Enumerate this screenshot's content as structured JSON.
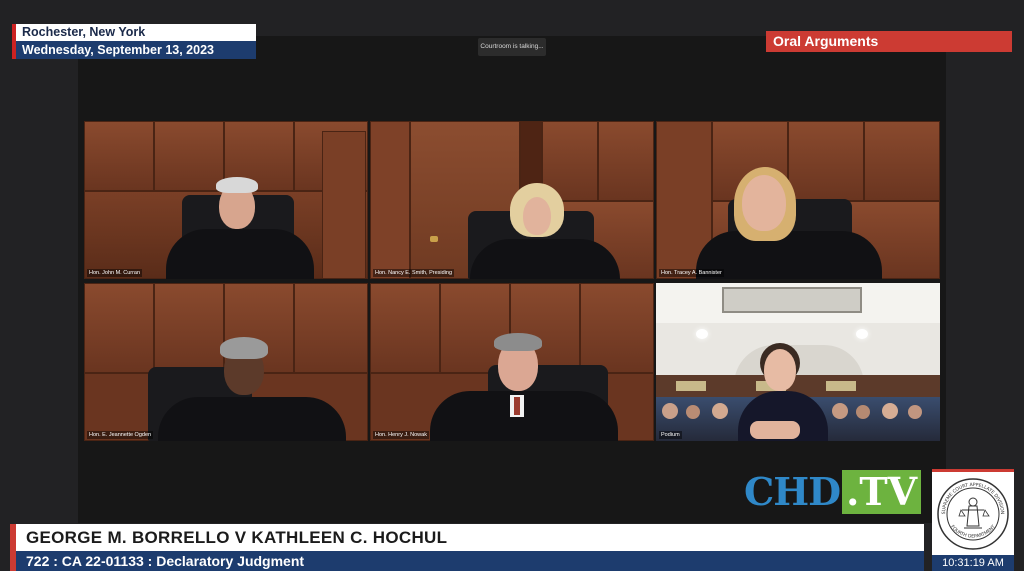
{
  "location": {
    "city": "Rochester, New York",
    "date": "Wednesday, September 13, 2023"
  },
  "status_text": "Courtroom is talking...",
  "banner": "Oral Arguments",
  "tiles": [
    {
      "name": "Hon. John M. Curran"
    },
    {
      "name": "Hon. Nancy E. Smith, Presiding"
    },
    {
      "name": "Hon. Tracey A. Bannister"
    },
    {
      "name": "Hon. E. Jeannette Ogden"
    },
    {
      "name": "Hon. Henry J. Nowak"
    },
    {
      "name": "Podium"
    }
  ],
  "logo": {
    "text": "CHD",
    "suffix": ".TV",
    "colors": {
      "blue": "#2f88c8",
      "green": "#6db33f"
    }
  },
  "seal": {
    "text_top": "SUPREME COURT APPELLATE DIVISION",
    "text_bottom": "FOURTH DEPARTMENT"
  },
  "clock": "10:31:19 AM",
  "case": {
    "title": "GEORGE M. BORRELLO V KATHLEEN C. HOCHUL",
    "subtitle": "722 : CA  22-01133 : Declaratory Judgment"
  },
  "colors": {
    "navy": "#1d3c6e",
    "red": "#cc3b33",
    "wood": "#8a4a2e"
  }
}
